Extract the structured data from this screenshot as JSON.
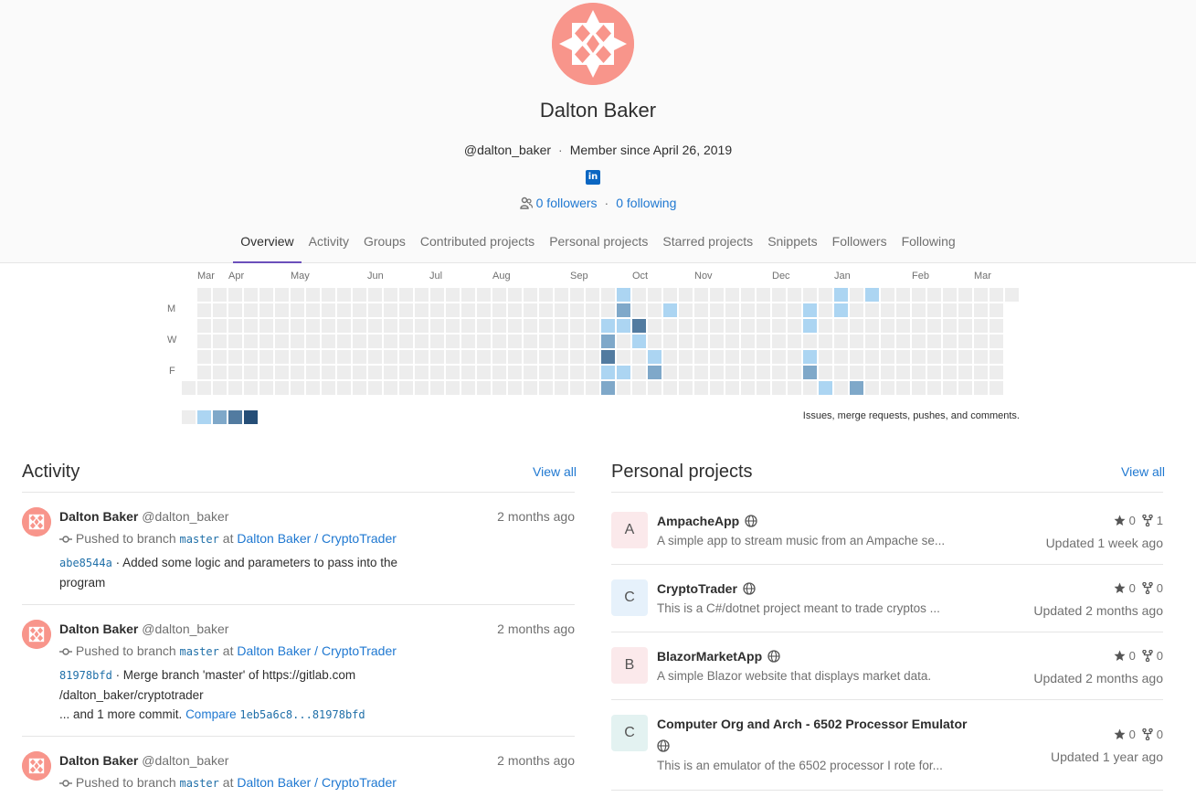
{
  "profile": {
    "name": "Dalton Baker",
    "username": "@dalton_baker",
    "member_since": "Member since April 26, 2019",
    "social_icon": "linkedin-icon",
    "social_label": "in",
    "followers": "0 followers",
    "following": "0 following"
  },
  "tabs": [
    "Overview",
    "Activity",
    "Groups",
    "Contributed projects",
    "Personal projects",
    "Starred projects",
    "Snippets",
    "Followers",
    "Following"
  ],
  "calendar": {
    "months": [
      "Mar",
      "Apr",
      "May",
      "Jun",
      "Jul",
      "Aug",
      "Sep",
      "Oct",
      "Nov",
      "Dec",
      "Jan",
      "Feb",
      "Mar"
    ],
    "day_labels": [
      "M",
      "W",
      "F"
    ],
    "note": "Issues, merge requests, pushes, and comments.",
    "colors": [
      "#ededed",
      "#acd5f2",
      "#7fa8c9",
      "#527ba0",
      "#254e77"
    ]
  },
  "activity": {
    "title": "Activity",
    "view_all": "View all",
    "events": [
      {
        "author": "Dalton Baker",
        "handle": "@dalton_baker",
        "time": "2 months ago",
        "pushed": "Pushed to branch",
        "branch": "master",
        "at": "at",
        "project": "Dalton Baker / CryptoTrader",
        "sha": "abe8544a",
        "message": "· Added some logic and parameters to pass into the program"
      },
      {
        "author": "Dalton Baker",
        "handle": "@dalton_baker",
        "time": "2 months ago",
        "pushed": "Pushed to branch",
        "branch": "master",
        "at": "at",
        "project": "Dalton Baker / CryptoTrader",
        "sha": "81978bfd",
        "message": "· Merge branch 'master' of https://gitlab.com /dalton_baker/cryptotrader",
        "more": "... and 1 more commit.",
        "compare_label": "Compare",
        "compare_range": "1eb5a6c8...81978bfd"
      },
      {
        "author": "Dalton Baker",
        "handle": "@dalton_baker",
        "time": "2 months ago",
        "pushed": "Pushed to branch",
        "branch": "master",
        "at": "at",
        "project": "Dalton Baker / CryptoTrader"
      }
    ]
  },
  "projects": {
    "title": "Personal projects",
    "view_all": "View all",
    "items": [
      {
        "letter": "A",
        "name": "AmpacheApp",
        "desc": "A simple app to stream music from an Ampache se...",
        "stars": "0",
        "forks": "1",
        "updated": "Updated 1 week ago",
        "color": "#fbe9eb"
      },
      {
        "letter": "C",
        "name": "CryptoTrader",
        "desc": "This is a C#/dotnet project meant to trade cryptos ...",
        "stars": "0",
        "forks": "0",
        "updated": "Updated 2 months ago",
        "color": "#e6f1fb"
      },
      {
        "letter": "B",
        "name": "BlazorMarketApp",
        "desc": "A simple Blazor website that displays market data.",
        "stars": "0",
        "forks": "0",
        "updated": "Updated 2 months ago",
        "color": "#fbe9eb"
      },
      {
        "letter": "C",
        "name": "Computer Org and Arch - 6502 Processor Emulator",
        "desc": "This is an emulator of the 6502 processor I rote for...",
        "stars": "0",
        "forks": "0",
        "updated": "Updated 1 year ago",
        "color": "#e3f2f1"
      }
    ]
  }
}
